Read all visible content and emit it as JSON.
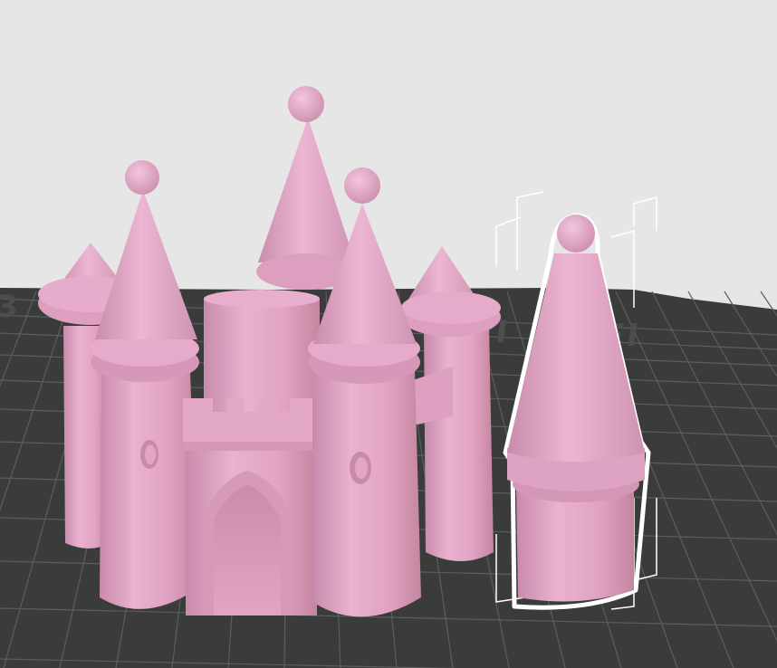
{
  "viewport": {
    "background_color": "#e6e6e6",
    "bed_color": "#3a3b3b",
    "grid_color": "#5c5e5e",
    "bed_logo_text": "PEI",
    "bed_logo_left_fragment": "3",
    "bed_logo_color": "#4c4e4e"
  },
  "objects": [
    {
      "name": "castle",
      "color": "#e4a7c6",
      "selected": false
    },
    {
      "name": "tower",
      "color": "#e4a7c6",
      "selected": true
    }
  ],
  "selection": {
    "outline_color": "#ffffff"
  }
}
